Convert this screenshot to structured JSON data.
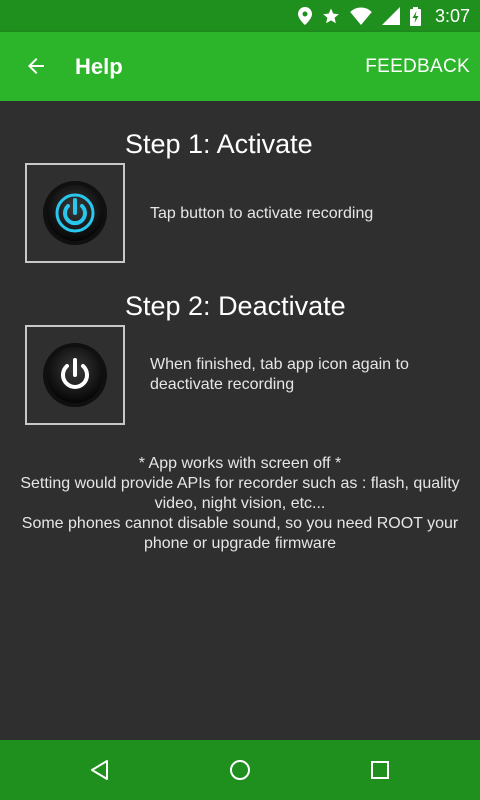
{
  "status_bar": {
    "time": "3:07",
    "icons": [
      "location-icon",
      "star-icon",
      "wifi-icon",
      "signal-icon",
      "battery-charging-icon"
    ]
  },
  "toolbar": {
    "back_icon": "arrow-back-icon",
    "title": "Help",
    "feedback_label": "FEEDBACK"
  },
  "steps": [
    {
      "title": "Step 1: Activate",
      "icon": "power-button-active-icon",
      "description": "Tap button to activate recording"
    },
    {
      "title": "Step 2: Deactivate",
      "icon": "power-button-inactive-icon",
      "description": "When finished, tab app icon again to deactivate recording"
    }
  ],
  "notes": {
    "line1": "* App works with screen off *",
    "line2": "Setting would provide APIs for recorder such as : flash, quality video, night vision, etc...",
    "line3": "Some phones cannot disable sound, so you need ROOT your phone or upgrade firmware"
  },
  "nav_bar": {
    "icons": [
      "nav-back-icon",
      "nav-home-icon",
      "nav-recents-icon"
    ]
  },
  "colors": {
    "status_bar": "#1f8f1d",
    "toolbar": "#2cb52a",
    "background": "#2f2f2f",
    "accent_cyan": "#29c7ee"
  }
}
